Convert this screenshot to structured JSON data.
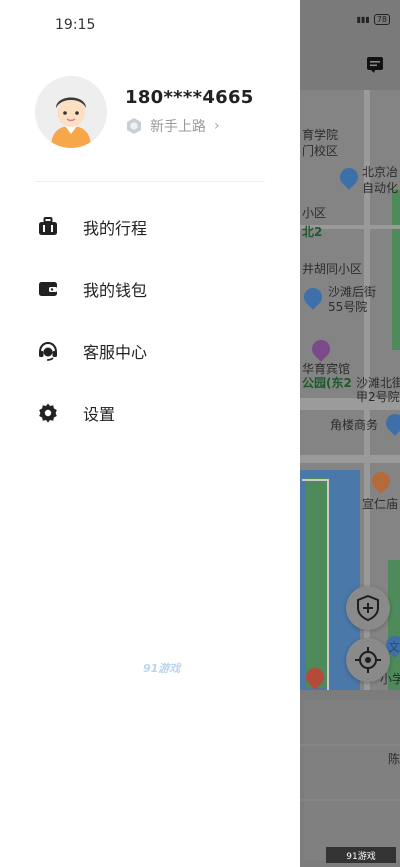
{
  "status_bar": {
    "time": "19:15",
    "battery": "78"
  },
  "user": {
    "phone": "180****4665",
    "level": "新手上路",
    "level_chevron": "›"
  },
  "menu": [
    {
      "label": "我的行程",
      "icon": "luggage-icon"
    },
    {
      "label": "我的钱包",
      "icon": "wallet-icon"
    },
    {
      "label": "客服中心",
      "icon": "headset-icon"
    },
    {
      "label": "设置",
      "icon": "gear-icon"
    }
  ],
  "map": {
    "labels": [
      "育学院",
      "门校区",
      "北京冶",
      "自动化",
      "小区",
      "北2",
      "井胡同小区",
      "沙滩后街",
      "55号院",
      "华育宾馆",
      "公园(东2",
      "沙滩北街",
      "甲2号院",
      "角楼商务",
      "宣仁庙",
      "文",
      "小学",
      "陈"
    ]
  },
  "watermark": {
    "center": "91游戏",
    "corner": "91游戏"
  }
}
